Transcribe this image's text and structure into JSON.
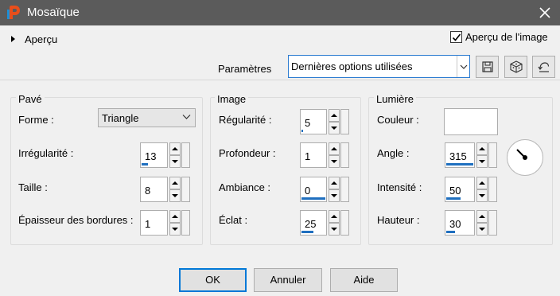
{
  "window": {
    "title": "Mosaïque"
  },
  "topbar": {
    "apercu_label": "Aperçu",
    "apercu_image_label": "Aperçu de l'image",
    "apercu_image_checked": true,
    "params_label": "Paramètres",
    "preset_value": "Dernières options utilisées"
  },
  "pave": {
    "title": "Pavé",
    "forme_label": "Forme :",
    "forme_value": "Triangle",
    "irregularite_label": "Irrégularité :",
    "irregularite_value": "13",
    "taille_label": "Taille :",
    "taille_value": "8",
    "epaisseur_label": "Épaisseur des bordures :",
    "epaisseur_value": "1"
  },
  "image": {
    "title": "Image",
    "regularite_label": "Régularité :",
    "regularite_value": "5",
    "profondeur_label": "Profondeur :",
    "profondeur_value": "1",
    "ambiance_label": "Ambiance :",
    "ambiance_value": "0",
    "eclat_label": "Éclat :",
    "eclat_value": "25"
  },
  "lumiere": {
    "title": "Lumière",
    "couleur_label": "Couleur :",
    "couleur_value": "#ffffff",
    "angle_label": "Angle :",
    "angle_value": "315",
    "intensite_label": "Intensité :",
    "intensite_value": "50",
    "hauteur_label": "Hauteur :",
    "hauteur_value": "30"
  },
  "footer": {
    "ok_label": "OK",
    "cancel_label": "Annuler",
    "help_label": "Aide"
  },
  "colors": {
    "titlebar": "#5b5b5b",
    "accent": "#1f6fbf",
    "focus_border": "#2a7ad0"
  }
}
